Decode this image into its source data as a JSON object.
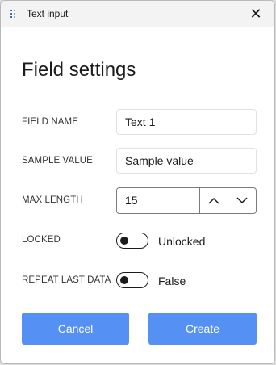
{
  "window": {
    "title": "Text input",
    "close_glyph": "✕"
  },
  "heading": "Field settings",
  "fields": {
    "field_name": {
      "label": "FIELD NAME",
      "value": "Text 1"
    },
    "sample_value": {
      "label": "SAMPLE VALUE",
      "value": "Sample value"
    },
    "max_length": {
      "label": "MAX LENGTH",
      "value": "15"
    },
    "locked": {
      "label": "LOCKED",
      "state": "Unlocked",
      "on": false
    },
    "repeat_last_data": {
      "label": "REPEAT LAST DATA",
      "state": "False",
      "on": false
    }
  },
  "buttons": {
    "cancel": "Cancel",
    "create": "Create"
  },
  "colors": {
    "accent": "#5591f5",
    "titlebar": "#f3f3f3"
  }
}
